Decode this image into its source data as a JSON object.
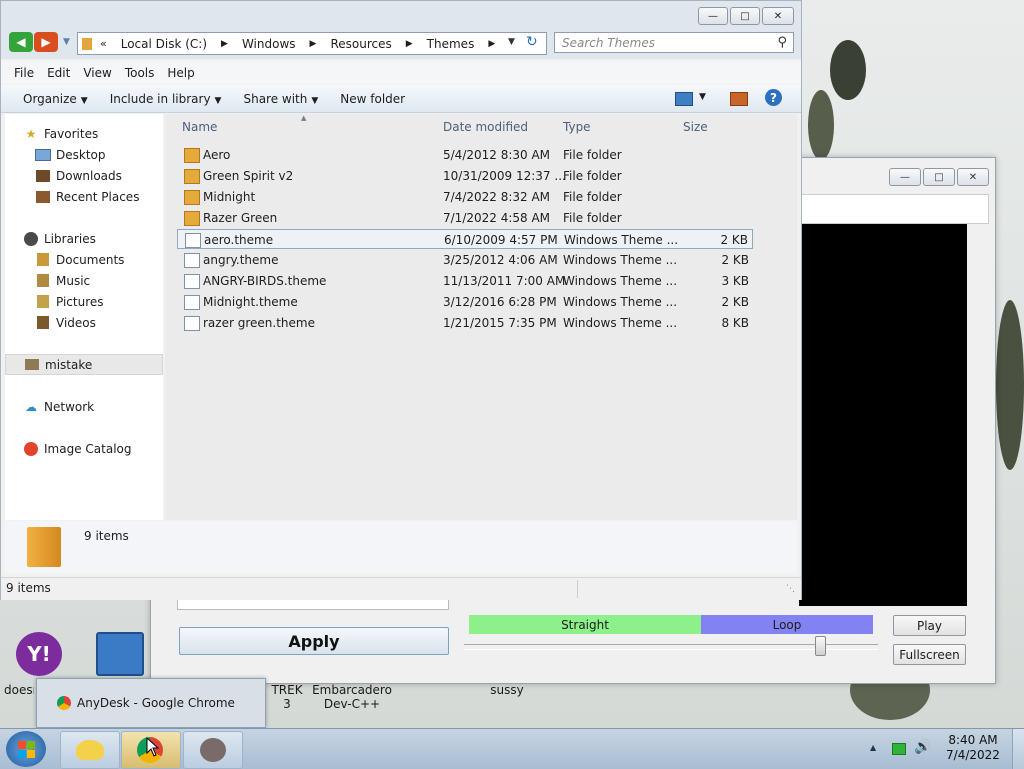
{
  "explorer": {
    "breadcrumb": [
      "Local Disk (C:)",
      "Windows",
      "Resources",
      "Themes"
    ],
    "search_placeholder": "Search Themes",
    "menu": [
      "File",
      "Edit",
      "View",
      "Tools",
      "Help"
    ],
    "toolbar": {
      "organize": "Organize",
      "include_in_library": "Include in library",
      "share_with": "Share with",
      "new_folder": "New folder"
    },
    "nav": {
      "favorites": "Favorites",
      "desktop": "Desktop",
      "downloads": "Downloads",
      "recent_places": "Recent Places",
      "libraries": "Libraries",
      "documents": "Documents",
      "music": "Music",
      "pictures": "Pictures",
      "videos": "Videos",
      "mistake": "mistake",
      "network": "Network",
      "image_catalog": "Image Catalog"
    },
    "columns": {
      "name": "Name",
      "date": "Date modified",
      "type": "Type",
      "size": "Size"
    },
    "files": [
      {
        "name": "Aero",
        "date": "5/4/2012 8:30 AM",
        "type": "File folder",
        "size": "",
        "kind": "folder"
      },
      {
        "name": "Green Spirit v2",
        "date": "10/31/2009 12:37 ...",
        "type": "File folder",
        "size": "",
        "kind": "folder"
      },
      {
        "name": "Midnight",
        "date": "7/4/2022 8:32 AM",
        "type": "File folder",
        "size": "",
        "kind": "folder"
      },
      {
        "name": "Razer Green",
        "date": "7/1/2022 4:58 AM",
        "type": "File folder",
        "size": "",
        "kind": "folder"
      },
      {
        "name": "aero.theme",
        "date": "6/10/2009 4:57 PM",
        "type": "Windows Theme ...",
        "size": "2 KB",
        "kind": "theme"
      },
      {
        "name": "angry.theme",
        "date": "3/25/2012 4:06 AM",
        "type": "Windows Theme ...",
        "size": "2 KB",
        "kind": "theme"
      },
      {
        "name": "ANGRY-BIRDS.theme",
        "date": "11/13/2011 7:00 AM",
        "type": "Windows Theme ...",
        "size": "3 KB",
        "kind": "theme"
      },
      {
        "name": "Midnight.theme",
        "date": "3/12/2016 6:28 PM",
        "type": "Windows Theme ...",
        "size": "2 KB",
        "kind": "theme"
      },
      {
        "name": "razer green.theme",
        "date": "1/21/2015 7:35 PM",
        "type": "Windows Theme ...",
        "size": "8 KB",
        "kind": "theme"
      }
    ],
    "details_count": "9 items",
    "status_count": "9 items"
  },
  "bg_app": {
    "apply": "Apply",
    "straight": "Straight",
    "loop": "Loop",
    "play": "Play",
    "fullscreen": "Fullscreen",
    "slider_fraction": 0.86,
    "colors": {
      "straight": "#8df08a",
      "loop": "#8282f2"
    }
  },
  "desktop": {
    "icons": [
      "doesn",
      "TREK 3",
      "Embarcadero Dev-C++",
      "sussy"
    ]
  },
  "popup": {
    "title": "AnyDesk - Google Chrome"
  },
  "tray": {
    "time": "8:40 AM",
    "date": "7/4/2022"
  }
}
